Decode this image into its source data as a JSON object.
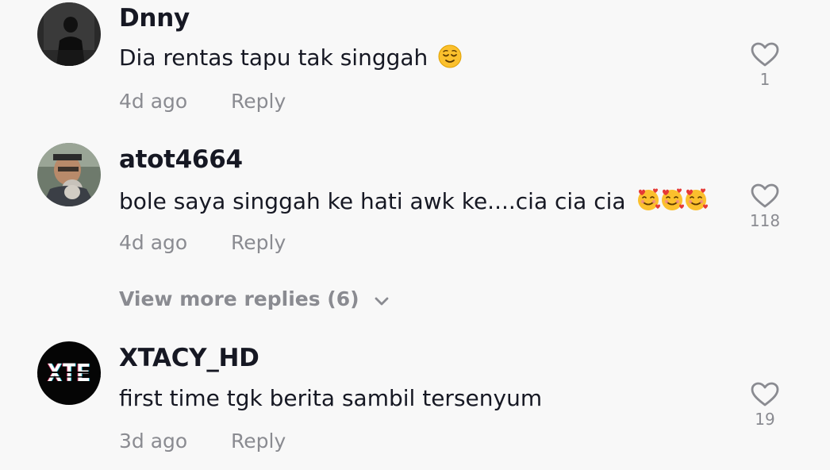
{
  "comments": [
    {
      "username": "Dnny",
      "text": "Dia rentas tapu tak singgah",
      "emojis": [
        "relieved-face"
      ],
      "time": "4d ago",
      "reply_label": "Reply",
      "likes": "1"
    },
    {
      "username": "atot4664",
      "text": "bole saya singgah ke hati awk ke....cia cia cia",
      "emojis": [
        "smiling-face-with-hearts",
        "smiling-face-with-hearts",
        "smiling-face-with-hearts"
      ],
      "time": "4d ago",
      "reply_label": "Reply",
      "likes": "118"
    },
    {
      "username": "XTACY_HD",
      "text": "first time tgk berita sambil tersenyum",
      "avatar_text": "XTE",
      "time": "3d ago",
      "reply_label": "Reply",
      "likes": "19"
    }
  ],
  "view_more_replies": "View more replies (6)",
  "colors": {
    "background": "#f8f8f8",
    "username": "#161823",
    "secondary": "#8a8b91"
  }
}
